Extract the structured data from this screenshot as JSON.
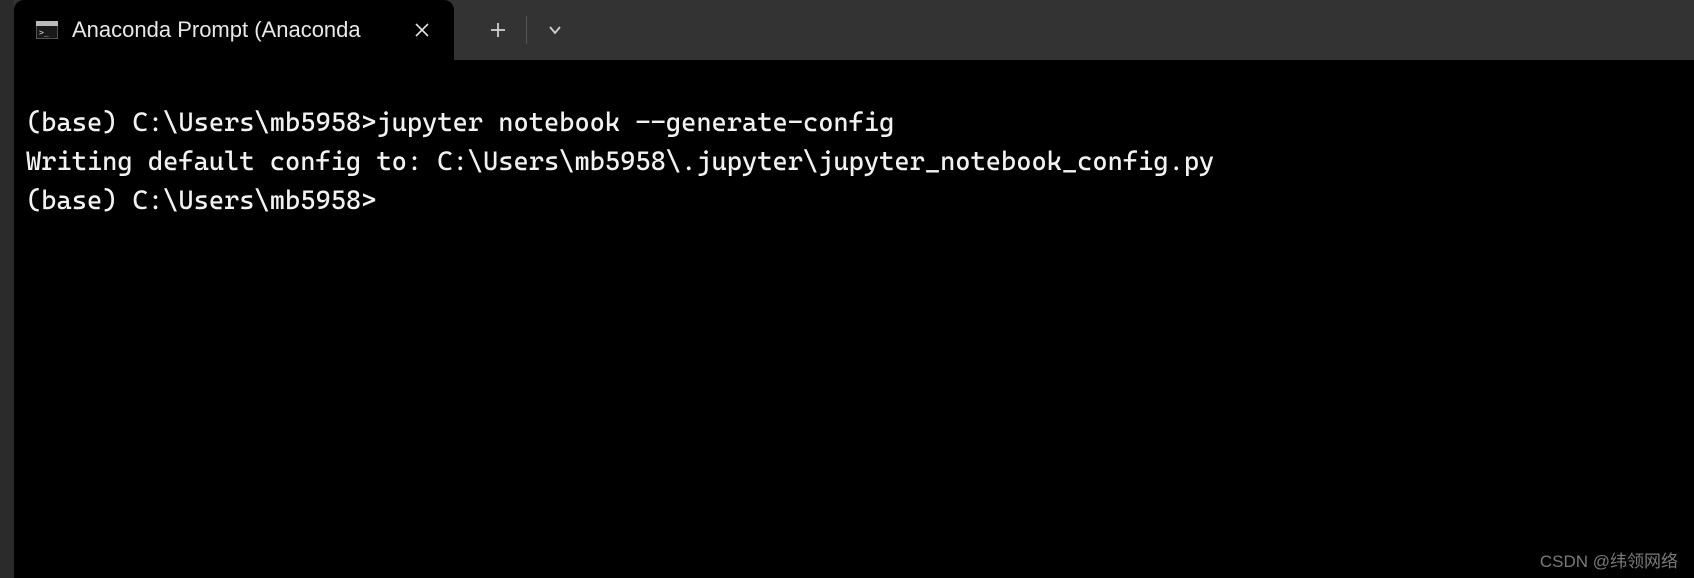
{
  "tab": {
    "title": "Anaconda Prompt (Anaconda"
  },
  "terminal": {
    "line1_prompt": "(base) C:\\Users\\mb5958>",
    "line1_cmd": "jupyter notebook --generate-config",
    "line2": "Writing default config to: C:\\Users\\mb5958\\.jupyter\\jupyter_notebook_config.py",
    "line3": "",
    "line4": "(base) C:\\Users\\mb5958>"
  },
  "watermark": "CSDN @纬领网络"
}
